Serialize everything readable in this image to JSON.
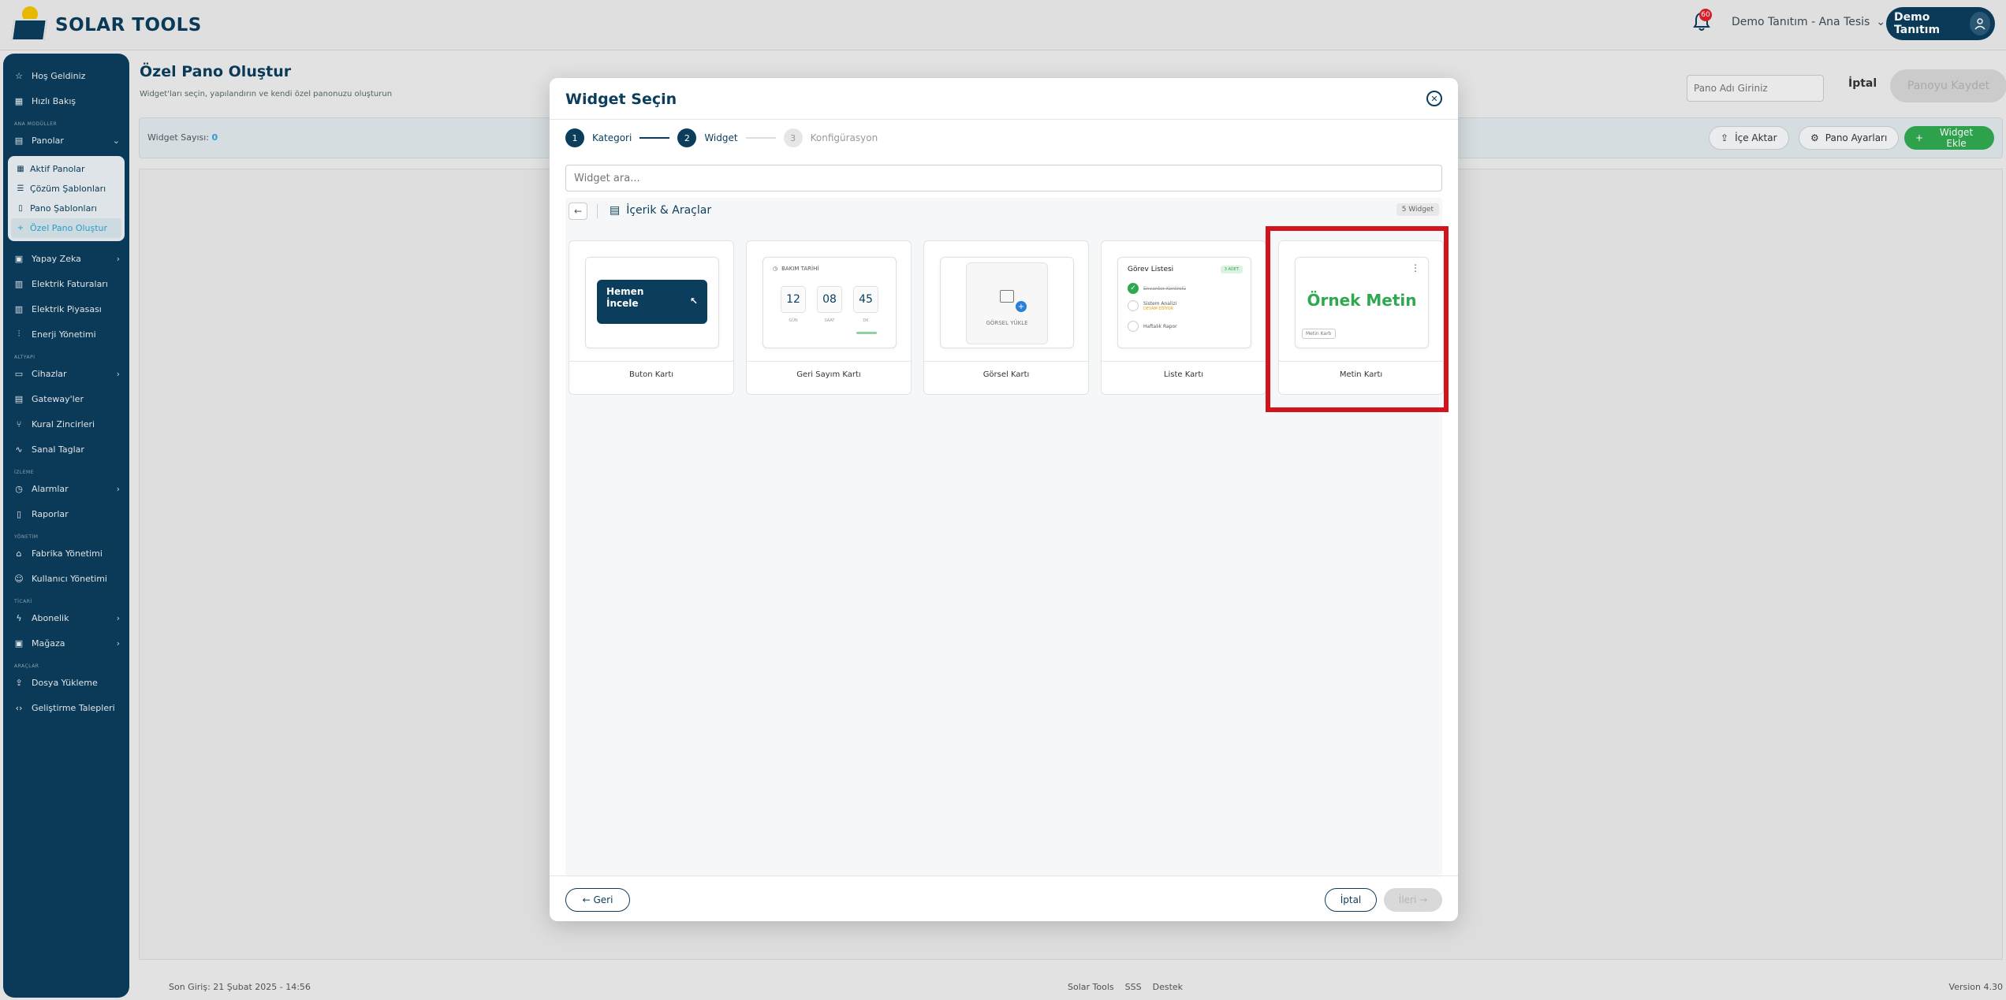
{
  "header": {
    "logo_text": "SOLAR TOOLS",
    "notification_count": "60",
    "tenant": "Demo Tanıtım - Ana Tesis",
    "user": "Demo Tanıtım"
  },
  "sidebar": {
    "items": [
      {
        "label": "Hoş Geldiniz",
        "icon": "star-icon"
      },
      {
        "label": "Hızlı Bakış",
        "icon": "grid-icon"
      }
    ],
    "sections": {
      "main_modules": "ANA MODÜLLER",
      "infrastructure": "ALTYAPI",
      "monitoring": "İZLEME",
      "management": "YÖNETİM",
      "commerce": "TİCARİ",
      "tools": "ARAÇLAR"
    },
    "panolar": "Panolar",
    "sub_items": [
      "Aktif Panolar",
      "Çözüm Şablonları",
      "Pano Şablonları",
      "Özel Pano Oluştur"
    ],
    "group1": [
      "Yapay Zeka",
      "Elektrik Faturaları",
      "Elektrik Piyasası",
      "Enerji Yönetimi"
    ],
    "group2": [
      "Cihazlar",
      "Gateway'ler",
      "Kural Zincirleri",
      "Sanal Taglar"
    ],
    "group3": [
      "Alarmlar",
      "Raporlar"
    ],
    "group4": [
      "Fabrika Yönetimi",
      "Kullanıcı Yönetimi"
    ],
    "group5": [
      "Abonelik",
      "Mağaza"
    ],
    "group6": [
      "Dosya Yükleme",
      "Geliştirme Talepleri"
    ]
  },
  "page": {
    "title": "Özel Pano Oluştur",
    "subtitle": "Widget'ları seçin, yapılandırın ve kendi özel panonuzu oluşturun",
    "name_placeholder": "Pano Adı Giriniz",
    "cancel": "İptal",
    "save": "Panoyu Kaydet",
    "widget_count_label": "Widget Sayısı:",
    "widget_count": "0",
    "import": "İçe Aktar",
    "settings": "Pano Ayarları",
    "add_widget": "Widget Ekle"
  },
  "footer": {
    "last_login": "Son Giriş: 21 Şubat 2025 - 14:56",
    "brand": "Solar Tools",
    "faq": "SSS",
    "support": "Destek",
    "version": "Version 4.30"
  },
  "modal": {
    "title": "Widget Seçin",
    "steps": [
      {
        "num": "1",
        "label": "Kategori"
      },
      {
        "num": "2",
        "label": "Widget"
      },
      {
        "num": "3",
        "label": "Konfigürasyon"
      }
    ],
    "search_placeholder": "Widget ara...",
    "category": "İçerik & Araçlar",
    "count": "5 Widget",
    "cards": [
      {
        "label": "Buton Kartı",
        "preview_text": "Hemen İncele"
      },
      {
        "label": "Geri Sayım Kartı",
        "preview_head": "BAKIM TARİHİ",
        "values": [
          "12",
          "08",
          "45"
        ],
        "units": [
          "GÜN",
          "SAAT",
          "DK"
        ]
      },
      {
        "label": "Görsel Kartı",
        "preview_text": "GÖRSEL YÜKLE"
      },
      {
        "label": "Liste Kartı",
        "preview_title": "Görev Listesi",
        "badge": "3 ADET",
        "rows": [
          "Envanter Kontrolü",
          "Sistem Analizi",
          "Haftalık Rapor"
        ],
        "row_tag": "DEVAM EDİYOR"
      },
      {
        "label": "Metin Kartı",
        "preview_text": "Örnek Metin",
        "tag": "Metin Kartı"
      }
    ],
    "back": "← Geri",
    "cancel": "İptal",
    "next": "İleri →"
  }
}
